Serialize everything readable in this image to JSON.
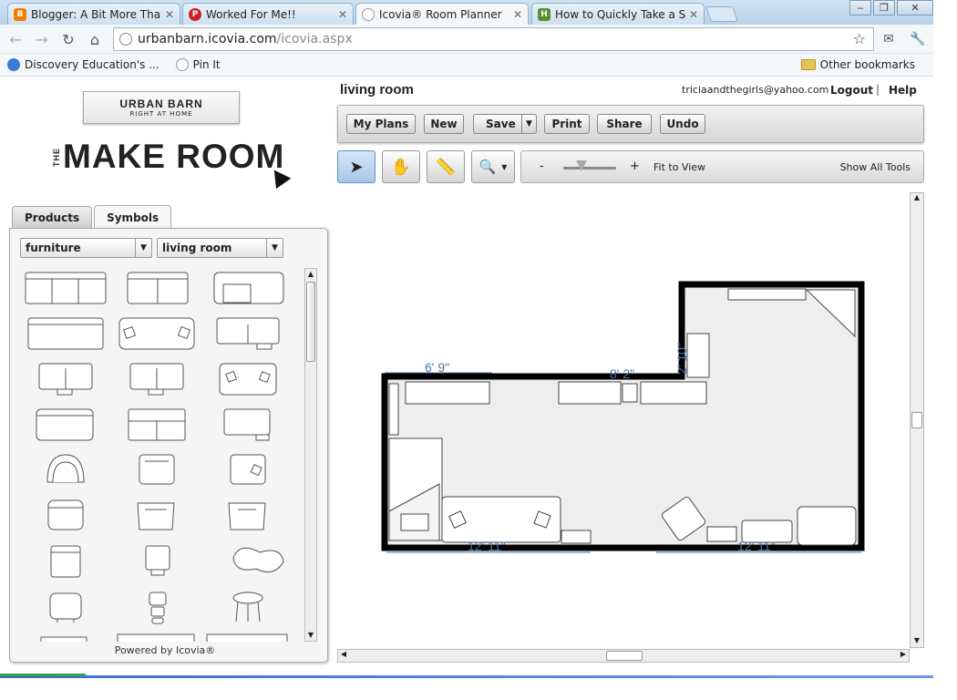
{
  "browser": {
    "tabs": [
      {
        "label": "Blogger: A Bit More Than A Jo",
        "color": "#f57d00",
        "glyph": "B"
      },
      {
        "label": "Worked For Me!!",
        "color": "#cb2027",
        "glyph": "P"
      },
      {
        "label": "Icovia® Room Planner",
        "color": "#999999",
        "glyph": ""
      },
      {
        "label": "How to Quickly Take a Screen",
        "color": "#5a8f2e",
        "glyph": "H"
      }
    ],
    "url_host": "urbanbarn.icovia.com",
    "url_path": "/icovia.aspx",
    "bookmarks": [
      "Discovery Education's ...",
      "Pin It"
    ],
    "other_bookmarks": "Other bookmarks"
  },
  "brand": {
    "logo_main": "URBAN BARN",
    "logo_sub": "RIGHT AT HOME",
    "the": "THE",
    "make_room": "MAKE ROOM"
  },
  "panel": {
    "tabs": [
      "Products",
      "Symbols"
    ],
    "category": "furniture",
    "room": "living room",
    "powered_by": "Powered by Icovia®"
  },
  "header": {
    "room_title": "living room",
    "email": "triciaandthegirls@yahoo.com",
    "logout": "Logout",
    "separator": "|",
    "help": "Help"
  },
  "toolbar": {
    "my_plans": "My Plans",
    "new": "New",
    "save": "Save",
    "print": "Print",
    "share": "Share",
    "undo": "Undo",
    "zoom_minus": "-",
    "zoom_plus": "+",
    "fit_to_view": "Fit to View",
    "show_all_tools": "Show All Tools"
  },
  "floorplan": {
    "dims": [
      "6' 9\"",
      "8' 2\"",
      "2' 10\"",
      "12' 11\"",
      "12' 11\""
    ],
    "dim_color": "#4a78a8"
  }
}
